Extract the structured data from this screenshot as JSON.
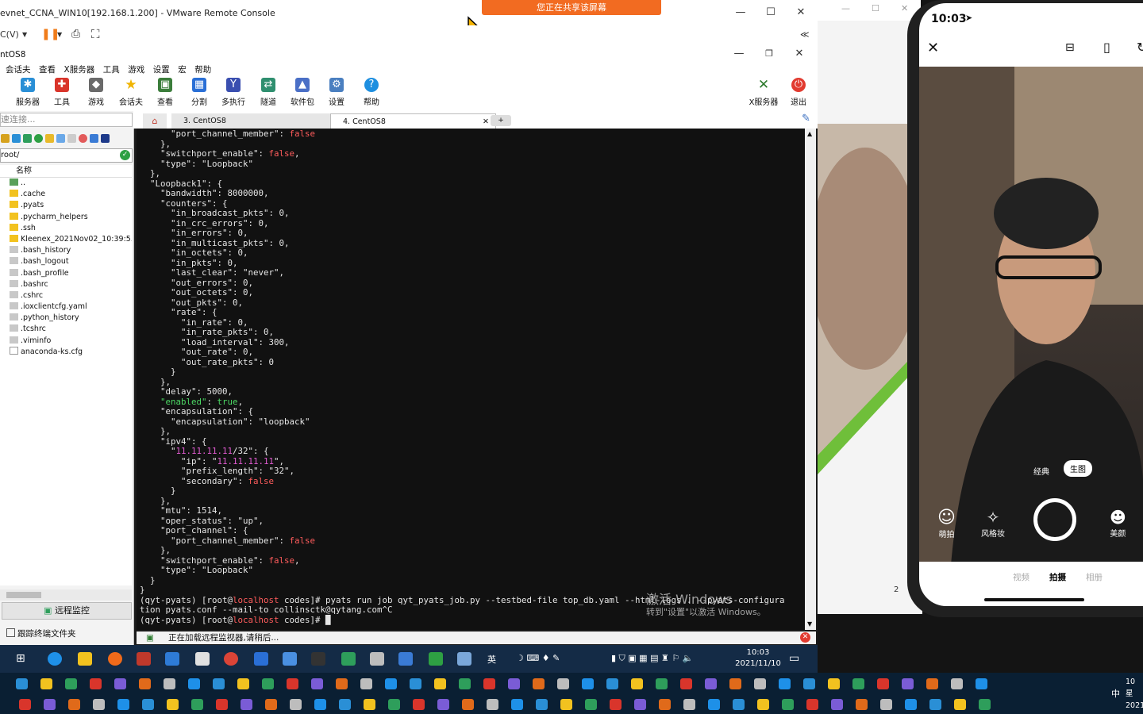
{
  "vmware": {
    "title": "evnet_CCNA_WIN10[192.168.1.200] - VMware Remote Console",
    "menu_label": "C(V)",
    "share_banner": "您正在共享该屏幕",
    "right_collapse": "≪"
  },
  "moba": {
    "session_title": "ntOS8",
    "menu": [
      "会话夫",
      "查看",
      "X服务器",
      "工具",
      "游戏",
      "设置",
      "宏",
      "帮助"
    ],
    "toolbar": [
      {
        "label": "服务器",
        "icon": "server-icon",
        "color": "#2a8fd6"
      },
      {
        "label": "工具",
        "icon": "tools-icon",
        "color": "#d9352b"
      },
      {
        "label": "游戏",
        "icon": "games-icon",
        "color": "#6a6a6a"
      },
      {
        "label": "会话夫",
        "icon": "sessions-star-icon",
        "color": "#f0b400"
      },
      {
        "label": "查看",
        "icon": "view-icon",
        "color": "#3b7d3b"
      },
      {
        "label": "分割",
        "icon": "split-icon",
        "color": "#2a6fd6"
      },
      {
        "label": "多执行",
        "icon": "multiexec-icon",
        "color": "#3a4fb0"
      },
      {
        "label": "隧道",
        "icon": "tunnel-icon",
        "color": "#2f8f6f"
      },
      {
        "label": "软件包",
        "icon": "packages-icon",
        "color": "#4a6fc6"
      },
      {
        "label": "设置",
        "icon": "settings-icon",
        "color": "#4a7fc0"
      },
      {
        "label": "帮助",
        "icon": "help-icon",
        "color": "#1e8fe0"
      }
    ],
    "right_toolbar": [
      {
        "label": "X服务器",
        "icon": "xserver-icon"
      },
      {
        "label": "退出",
        "icon": "exit-power-icon"
      }
    ],
    "quick_connect_placeholder": "速连接...",
    "path": "root/",
    "file_header": "名称",
    "files": [
      {
        "name": "..",
        "type": "up"
      },
      {
        "name": ".cache",
        "type": "folder"
      },
      {
        "name": ".pyats",
        "type": "folder"
      },
      {
        "name": ".pycharm_helpers",
        "type": "folder"
      },
      {
        "name": ".ssh",
        "type": "folder"
      },
      {
        "name": "Kleenex_2021Nov02_10:39:5...",
        "type": "folder"
      },
      {
        "name": ".bash_history",
        "type": "file"
      },
      {
        "name": ".bash_logout",
        "type": "file"
      },
      {
        "name": ".bash_profile",
        "type": "file"
      },
      {
        "name": ".bashrc",
        "type": "file"
      },
      {
        "name": ".cshrc",
        "type": "file"
      },
      {
        "name": ".ioxclientcfg.yaml",
        "type": "file"
      },
      {
        "name": ".python_history",
        "type": "file"
      },
      {
        "name": ".tcshrc",
        "type": "file"
      },
      {
        "name": ".viminfo",
        "type": "file"
      },
      {
        "name": "anaconda-ks.cfg",
        "type": "cfg"
      }
    ],
    "remote_monitor": "远程监控",
    "follow_terminal": "跟踪终端文件夹",
    "tabs": [
      {
        "label": "3. CentOS8",
        "active": false
      },
      {
        "label": "4. CentOS8",
        "active": true
      }
    ],
    "status_text": "正在加载远程监视器,请稍后...",
    "watermark_title": "激活 Windows",
    "watermark_sub": "转到\"设置\"以激活 Windows。"
  },
  "terminal_lines": [
    [
      [
        "      \"port_channel_member\": ",
        "k"
      ],
      [
        "false",
        "r"
      ]
    ],
    [
      [
        "    },",
        "k"
      ]
    ],
    [
      [
        "    \"switchport_enable\": ",
        "k"
      ],
      [
        "false",
        "r"
      ],
      [
        ",",
        "k"
      ]
    ],
    [
      [
        "    \"type\": \"Loopback\"",
        "k"
      ]
    ],
    [
      [
        "  },",
        "k"
      ]
    ],
    [
      [
        "  \"Loopback1\": {",
        "k"
      ]
    ],
    [
      [
        "    \"bandwidth\": 8000000,",
        "k"
      ]
    ],
    [
      [
        "    \"counters\": {",
        "k"
      ]
    ],
    [
      [
        "      \"in_broadcast_pkts\": 0,",
        "k"
      ]
    ],
    [
      [
        "      \"in_crc_errors\": 0,",
        "k"
      ]
    ],
    [
      [
        "      \"in_errors\": 0,",
        "k"
      ]
    ],
    [
      [
        "      \"in_multicast_pkts\": 0,",
        "k"
      ]
    ],
    [
      [
        "      \"in_octets\": 0,",
        "k"
      ]
    ],
    [
      [
        "      \"in_pkts\": 0,",
        "k"
      ]
    ],
    [
      [
        "      \"last_clear\": \"never\",",
        "k"
      ]
    ],
    [
      [
        "      \"out_errors\": 0,",
        "k"
      ]
    ],
    [
      [
        "      \"out_octets\": 0,",
        "k"
      ]
    ],
    [
      [
        "      \"out_pkts\": 0,",
        "k"
      ]
    ],
    [
      [
        "      \"rate\": {",
        "k"
      ]
    ],
    [
      [
        "        \"in_rate\": 0,",
        "k"
      ]
    ],
    [
      [
        "        \"in_rate_pkts\": 0,",
        "k"
      ]
    ],
    [
      [
        "        \"load_interval\": 300,",
        "k"
      ]
    ],
    [
      [
        "        \"out_rate\": 0,",
        "k"
      ]
    ],
    [
      [
        "        \"out_rate_pkts\": 0",
        "k"
      ]
    ],
    [
      [
        "      }",
        "k"
      ]
    ],
    [
      [
        "    },",
        "k"
      ]
    ],
    [
      [
        "    \"delay\": 5000,",
        "k"
      ]
    ],
    [
      [
        "    ",
        "k"
      ],
      [
        "\"enabled\"",
        "g"
      ],
      [
        ": ",
        "k"
      ],
      [
        "true",
        "g"
      ],
      [
        ",",
        "k"
      ]
    ],
    [
      [
        "    \"encapsulation\": {",
        "k"
      ]
    ],
    [
      [
        "      \"encapsulation\": \"loopback\"",
        "k"
      ]
    ],
    [
      [
        "    },",
        "k"
      ]
    ],
    [
      [
        "    \"ipv4\": {",
        "k"
      ]
    ],
    [
      [
        "      \"",
        "k"
      ],
      [
        "11.11.11.11",
        "p"
      ],
      [
        "/32\": {",
        "k"
      ]
    ],
    [
      [
        "        \"ip\": \"",
        "k"
      ],
      [
        "11.11.11.11",
        "p"
      ],
      [
        "\",",
        "k"
      ]
    ],
    [
      [
        "        \"prefix_length\": \"32\",",
        "k"
      ]
    ],
    [
      [
        "        \"secondary\": ",
        "k"
      ],
      [
        "false",
        "r"
      ]
    ],
    [
      [
        "      }",
        "k"
      ]
    ],
    [
      [
        "    },",
        "k"
      ]
    ],
    [
      [
        "    \"mtu\": 1514,",
        "k"
      ]
    ],
    [
      [
        "    \"oper_status\": \"up\",",
        "k"
      ]
    ],
    [
      [
        "    \"port_channel\": {",
        "k"
      ]
    ],
    [
      [
        "      \"port_channel_member\": ",
        "k"
      ],
      [
        "false",
        "r"
      ]
    ],
    [
      [
        "    },",
        "k"
      ]
    ],
    [
      [
        "    \"switchport_enable\": ",
        "k"
      ],
      [
        "false",
        "r"
      ],
      [
        ",",
        "k"
      ]
    ],
    [
      [
        "    \"type\": \"Loopback\"",
        "k"
      ]
    ],
    [
      [
        "  }",
        "k"
      ]
    ],
    [
      [
        "}",
        "k"
      ]
    ],
    [
      [
        "(qyt-pyats) [root@",
        "k"
      ],
      [
        "localhost",
        "r"
      ],
      [
        " codes]# pyats run job qyt_pyats_job.py --testbed-file top_db.yaml --html-logs . --pyats-configura",
        "k"
      ]
    ],
    [
      [
        "tion pyats.conf --mail-to collinsctk@qytang.com^C",
        "k"
      ]
    ],
    [
      [
        "(qyt-pyats) [root@",
        "k"
      ],
      [
        "localhost",
        "r"
      ],
      [
        " codes]# ",
        "k"
      ],
      [
        "█",
        "k"
      ]
    ]
  ],
  "remote_taskbar": {
    "time": "10:03",
    "date": "2021/11/10",
    "ime": "英"
  },
  "phone": {
    "time": "10:03",
    "modes_top": [
      "经典",
      "生图"
    ],
    "actions": [
      {
        "label": "萌拍",
        "icon": "smile-face-icon"
      },
      {
        "label": "风格妆",
        "icon": "magic-wand-icon"
      },
      {
        "label": "美颜",
        "icon": "beauty-face-icon"
      }
    ],
    "bottom_tabs": [
      "视频",
      "拍摄",
      "相册"
    ],
    "active_tab": "拍摄"
  },
  "slide_page_number": "2",
  "host_taskbar": {
    "ime": "中",
    "clock_line1": "10",
    "clock_line2": "星",
    "clock_line3": "2021"
  }
}
